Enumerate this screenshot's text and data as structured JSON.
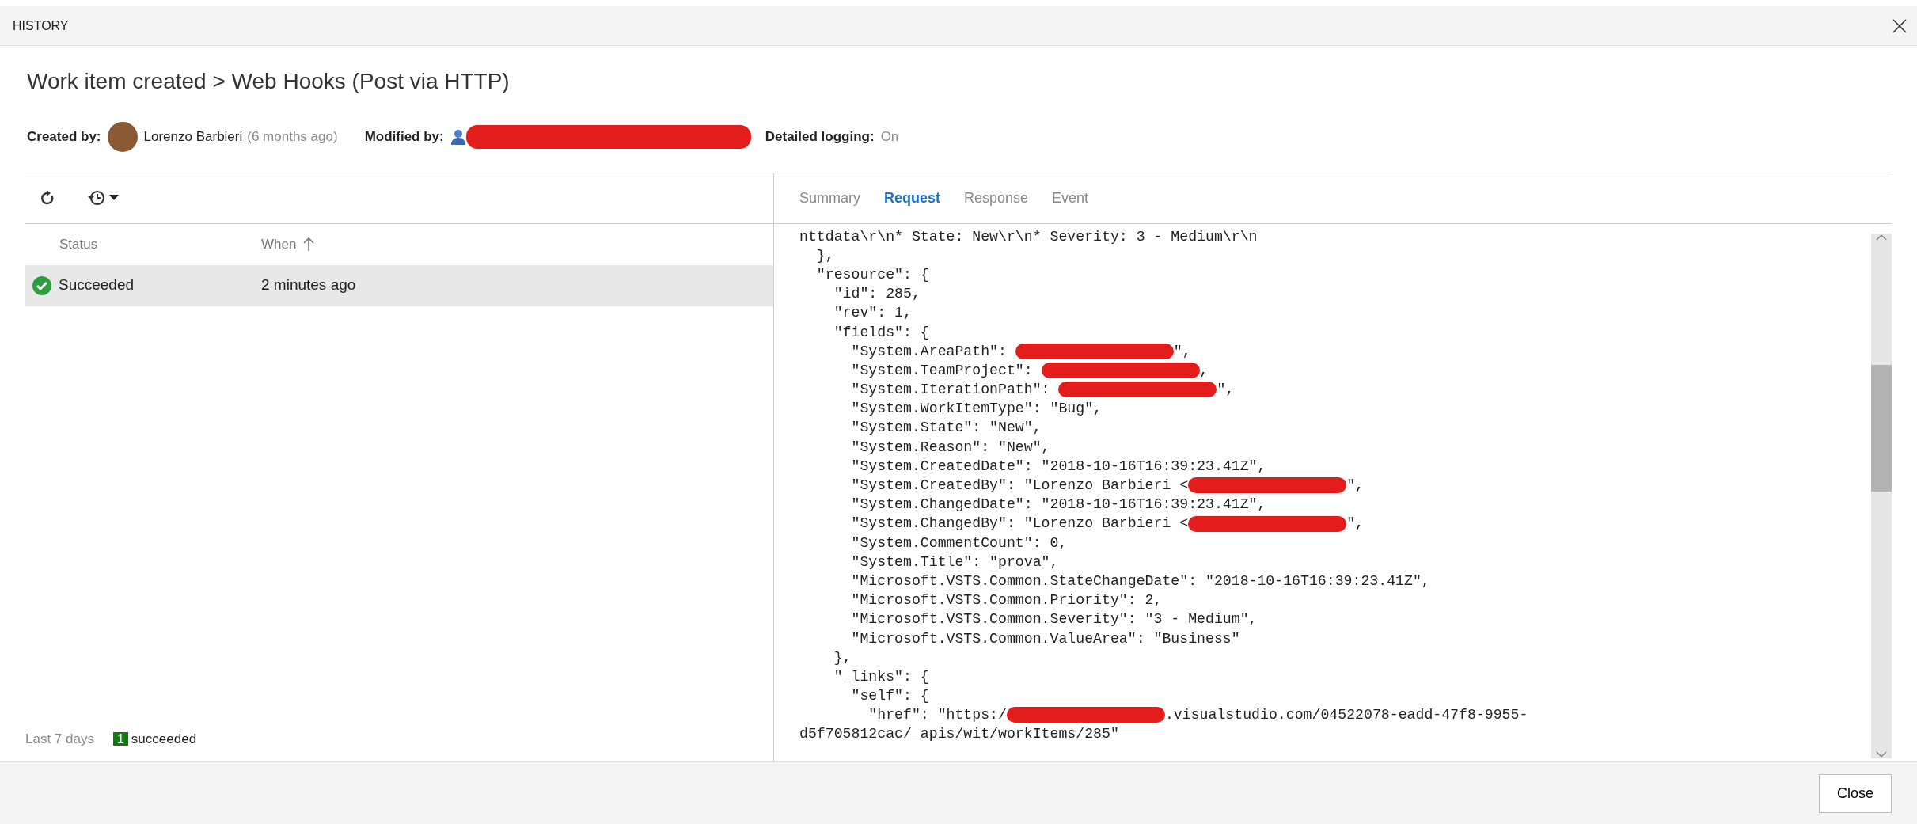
{
  "dialog": {
    "title": "HISTORY"
  },
  "heading": "Work item created > Web Hooks (Post via HTTP)",
  "meta": {
    "created_by_label": "Created by:",
    "created_by": "Lorenzo Barbieri",
    "created_ago": "(6 months ago)",
    "modified_by_label": "Modified by:",
    "modified_by_redacted": true,
    "logging_label": "Detailed logging:",
    "logging_value": "On"
  },
  "table": {
    "columns": [
      {
        "label": "Status",
        "sorted": false
      },
      {
        "label": "When",
        "sorted": true
      }
    ],
    "rows": [
      {
        "status": "Succeeded",
        "when": "2 minutes ago",
        "selected": true,
        "kind": "success"
      }
    ]
  },
  "summary": {
    "label": "Last 7 days",
    "count": "1",
    "text": "succeeded"
  },
  "tabs": [
    {
      "label": "Summary",
      "selected": false
    },
    {
      "label": "Request",
      "selected": true
    },
    {
      "label": "Response",
      "selected": false
    },
    {
      "label": "Event",
      "selected": false
    }
  ],
  "code_lines": [
    {
      "text": "nttdata\\r\\n* State: New\\r\\n* Severity: 3 - Medium\\r\\n"
    },
    {
      "text": "  },"
    },
    {
      "text": "  \"resource\": {"
    },
    {
      "text": "    \"id\": 285,"
    },
    {
      "text": "    \"rev\": 1,"
    },
    {
      "text": "    \"fields\": {"
    },
    {
      "text": "      \"System.AreaPath\": ",
      "redacted": true,
      "after": "\","
    },
    {
      "text": "      \"System.TeamProject\": ",
      "redacted": true,
      "after": ","
    },
    {
      "text": "      \"System.IterationPath\": ",
      "redacted": true,
      "after": "\","
    },
    {
      "text": "      \"System.WorkItemType\": \"Bug\","
    },
    {
      "text": "      \"System.State\": \"New\","
    },
    {
      "text": "      \"System.Reason\": \"New\","
    },
    {
      "text": "      \"System.CreatedDate\": \"2018-10-16T16:39:23.41Z\","
    },
    {
      "text": "      \"System.CreatedBy\": \"Lorenzo Barbieri <",
      "redacted": true,
      "after": "\","
    },
    {
      "text": "      \"System.ChangedDate\": \"2018-10-16T16:39:23.41Z\","
    },
    {
      "text": "      \"System.ChangedBy\": \"Lorenzo Barbieri <",
      "redacted": true,
      "after": "\","
    },
    {
      "text": "      \"System.CommentCount\": 0,"
    },
    {
      "text": "      \"System.Title\": \"prova\","
    },
    {
      "text": "      \"Microsoft.VSTS.Common.StateChangeDate\": \"2018-10-16T16:39:23.41Z\","
    },
    {
      "text": "      \"Microsoft.VSTS.Common.Priority\": 2,"
    },
    {
      "text": "      \"Microsoft.VSTS.Common.Severity\": \"3 - Medium\","
    },
    {
      "text": "      \"Microsoft.VSTS.Common.ValueArea\": \"Business\""
    },
    {
      "text": "    },"
    },
    {
      "text": "    \"_links\": {"
    },
    {
      "text": "      \"self\": {"
    },
    {
      "text": "        \"href\": \"https:/",
      "redacted": true,
      "after": ".visualstudio.com/04522078-eadd-47f8-9955-"
    },
    {
      "text": "d5f705812cac/_apis/wit/workItems/285\""
    }
  ],
  "buttons": [
    {
      "label": "Close"
    }
  ]
}
